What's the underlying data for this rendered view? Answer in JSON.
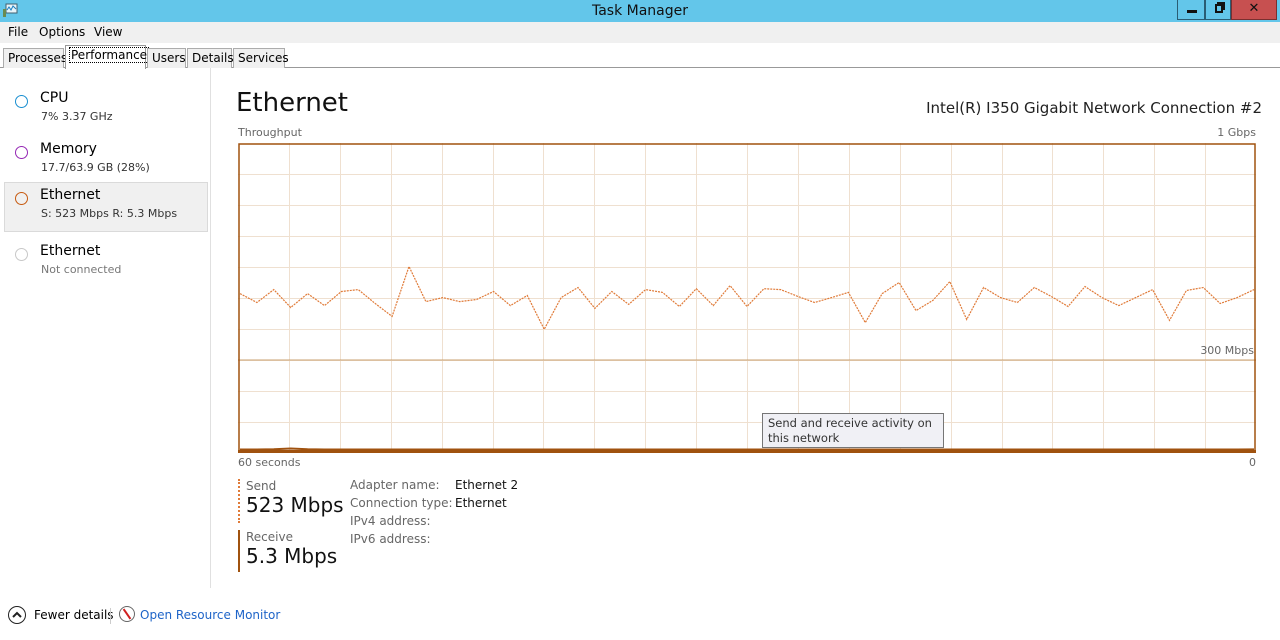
{
  "window": {
    "title": "Task Manager",
    "icons": {
      "app": "task-manager-icon",
      "minimize": "minimize-icon",
      "restore": "restore-icon",
      "close": "close-icon"
    }
  },
  "menu": [
    "File",
    "Options",
    "View"
  ],
  "tabs": [
    {
      "label": "Processes",
      "active": false
    },
    {
      "label": "Performance",
      "active": true
    },
    {
      "label": "Users",
      "active": false
    },
    {
      "label": "Details",
      "active": false
    },
    {
      "label": "Services",
      "active": false
    }
  ],
  "sidebar": {
    "items": [
      {
        "name": "CPU",
        "detail": "7% 3.37 GHz",
        "color": "#1a8fd1",
        "selected": false
      },
      {
        "name": "Memory",
        "detail": "17.7/63.9 GB (28%)",
        "color": "#9528b4",
        "selected": false
      },
      {
        "name": "Ethernet",
        "detail": "S: 523 Mbps R: 5.3 Mbps",
        "color": "#c75a10",
        "selected": true
      },
      {
        "name": "Ethernet",
        "detail": "Not connected",
        "color": "#c8c8c8",
        "selected": false
      }
    ]
  },
  "main": {
    "title": "Ethernet",
    "adapter": "Intel(R) I350 Gigabit Network Connection #2",
    "tooltip": "Send and receive activity on this network",
    "stats": {
      "send_label": "Send",
      "send_value": "523 Mbps",
      "receive_label": "Receive",
      "receive_value": "5.3 Mbps"
    },
    "properties": [
      {
        "key": "Adapter name:",
        "value": "Ethernet 2"
      },
      {
        "key": "Connection type:",
        "value": "Ethernet"
      },
      {
        "key": "IPv4 address:",
        "value": ""
      },
      {
        "key": "IPv6 address:",
        "value": ""
      }
    ]
  },
  "footer": {
    "fewer_details": "Fewer details",
    "open_resource_monitor": "Open Resource Monitor"
  },
  "colors": {
    "graph_border": "#a0520f",
    "grid": "#efe0d0",
    "send_line": "#e07b39",
    "receive_line": "#a0520f",
    "scale_line": "#c8a070"
  },
  "chart_data": {
    "type": "line",
    "title": "Throughput",
    "ylabel_top": "1 Gbps",
    "scale_marker_label": "300 Mbps",
    "scale_marker_value": 300,
    "xlabel_left": "60 seconds",
    "xlabel_right": "0",
    "ylim": [
      0,
      1000
    ],
    "xlim": [
      60,
      0
    ],
    "grid": true,
    "series": [
      {
        "name": "Send",
        "style": "dashed",
        "unit": "Mbps",
        "values": [
          511,
          482,
          524,
          466,
          511,
          472,
          518,
          524,
          479,
          437,
          599,
          485,
          498,
          485,
          492,
          518,
          472,
          505,
          395,
          498,
          531,
          463,
          518,
          476,
          524,
          515,
          469,
          527,
          472,
          537,
          469,
          527,
          524,
          502,
          482,
          498,
          515,
          417,
          511,
          547,
          456,
          489,
          550,
          427,
          531,
          498,
          482,
          531,
          502,
          469,
          534,
          498,
          472,
          498,
          524,
          424,
          521,
          531,
          479,
          498,
          524
        ]
      },
      {
        "name": "Receive",
        "style": "solid",
        "unit": "Mbps",
        "values": [
          5,
          5,
          6,
          8,
          6,
          5,
          5,
          5,
          5,
          5,
          5,
          5,
          5,
          5,
          5,
          5,
          5,
          5,
          5,
          5,
          5,
          5,
          5,
          5,
          5,
          5,
          5,
          5,
          5,
          5,
          5,
          5,
          5,
          5,
          5,
          5,
          5,
          5,
          5,
          5,
          5,
          5,
          5,
          5,
          5,
          5,
          5,
          5,
          5,
          5,
          5,
          5,
          5,
          5,
          5,
          5,
          5,
          5,
          5,
          5,
          5.3
        ]
      }
    ]
  }
}
